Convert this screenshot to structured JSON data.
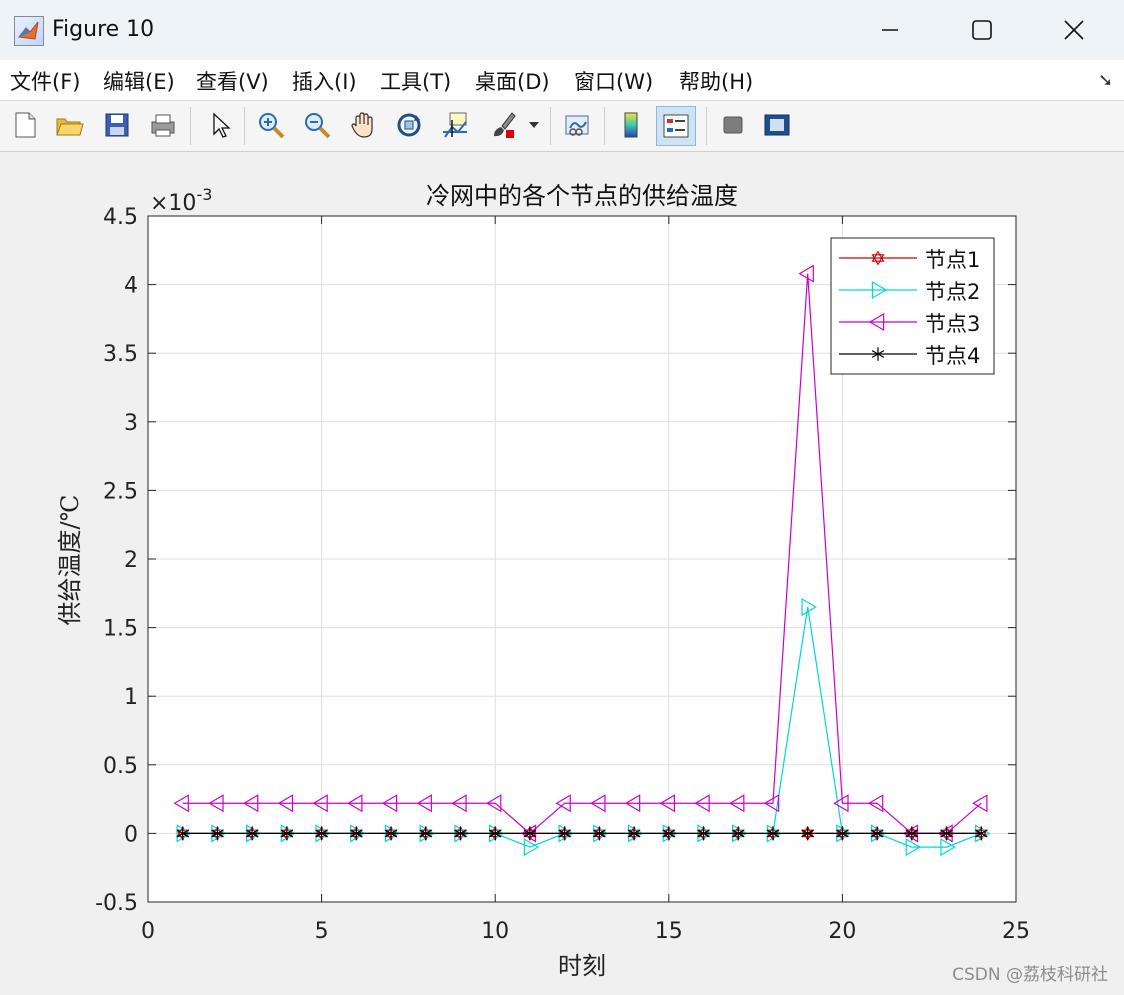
{
  "window": {
    "title": "Figure 10",
    "icon": "matlab-icon",
    "controls": [
      "minimize-icon",
      "maximize-icon",
      "close-icon"
    ]
  },
  "menubar": {
    "items": [
      "文件(F)",
      "编辑(E)",
      "查看(V)",
      "插入(I)",
      "工具(T)",
      "桌面(D)",
      "窗口(W)",
      "帮助(H)"
    ]
  },
  "toolbar": {
    "icons": [
      "new-figure-icon",
      "open-icon",
      "save-icon",
      "print-icon",
      "edit-plot-icon",
      "zoom-in-icon",
      "zoom-out-icon",
      "pan-icon",
      "rotate-3d-icon",
      "data-cursor-icon",
      "brush-icon",
      "link-plot-icon",
      "colorbar-icon",
      "legend-icon",
      "hide-plot-tools-icon",
      "show-plot-tools-icon"
    ]
  },
  "watermark": "CSDN @荔枝科研社",
  "chart_data": {
    "type": "line",
    "title": "冷网中的各个节点的供给温度",
    "xlabel": "时刻",
    "ylabel": "供给温度/℃",
    "exponent_label": "×10",
    "exponent_power": "-3",
    "xlim": [
      0,
      25
    ],
    "ylim": [
      -0.5,
      4.5
    ],
    "xticks": [
      0,
      5,
      10,
      15,
      20,
      25
    ],
    "yticks": [
      -0.5,
      0,
      0.5,
      1,
      1.5,
      2,
      2.5,
      3,
      3.5,
      4,
      4.5
    ],
    "ytick_labels": [
      "-0.5",
      "0",
      "0.5",
      "1",
      "1.5",
      "2",
      "2.5",
      "3",
      "3.5",
      "4",
      "4.5"
    ],
    "grid": true,
    "legend_position": "top-right",
    "x": [
      1,
      2,
      3,
      4,
      5,
      6,
      7,
      8,
      9,
      10,
      11,
      12,
      13,
      14,
      15,
      16,
      17,
      18,
      19,
      20,
      21,
      22,
      23,
      24
    ],
    "series": [
      {
        "name": "节点1",
        "color": "#cc0000",
        "marker": "hexagram",
        "values": [
          0,
          0,
          0,
          0,
          0,
          0,
          0,
          0,
          0,
          0,
          0,
          0,
          0,
          0,
          0,
          0,
          0,
          0,
          0,
          0,
          0,
          0,
          0,
          0
        ]
      },
      {
        "name": "节点2",
        "color": "#00d7d7",
        "marker": "triangle-right",
        "values": [
          0,
          0,
          0,
          0,
          0,
          0,
          0,
          0,
          0,
          0,
          -0.1,
          0,
          0,
          0,
          0,
          0,
          0,
          0,
          1.65,
          0,
          0,
          -0.1,
          -0.1,
          0
        ]
      },
      {
        "name": "节点3",
        "color": "#cc00cc",
        "marker": "triangle-left",
        "values": [
          0.22,
          0.22,
          0.22,
          0.22,
          0.22,
          0.22,
          0.22,
          0.22,
          0.22,
          0.22,
          0,
          0.22,
          0.22,
          0.22,
          0.22,
          0.22,
          0.22,
          0.22,
          4.08,
          0.22,
          0.22,
          0,
          0,
          0.22
        ]
      },
      {
        "name": "节点4",
        "color": "#000000",
        "marker": "asterisk",
        "values": [
          0,
          0,
          0,
          0,
          0,
          0,
          0,
          0,
          0,
          0,
          0,
          0,
          0,
          0,
          0,
          0,
          0,
          0,
          0,
          0,
          0,
          0,
          0,
          0
        ]
      }
    ]
  }
}
